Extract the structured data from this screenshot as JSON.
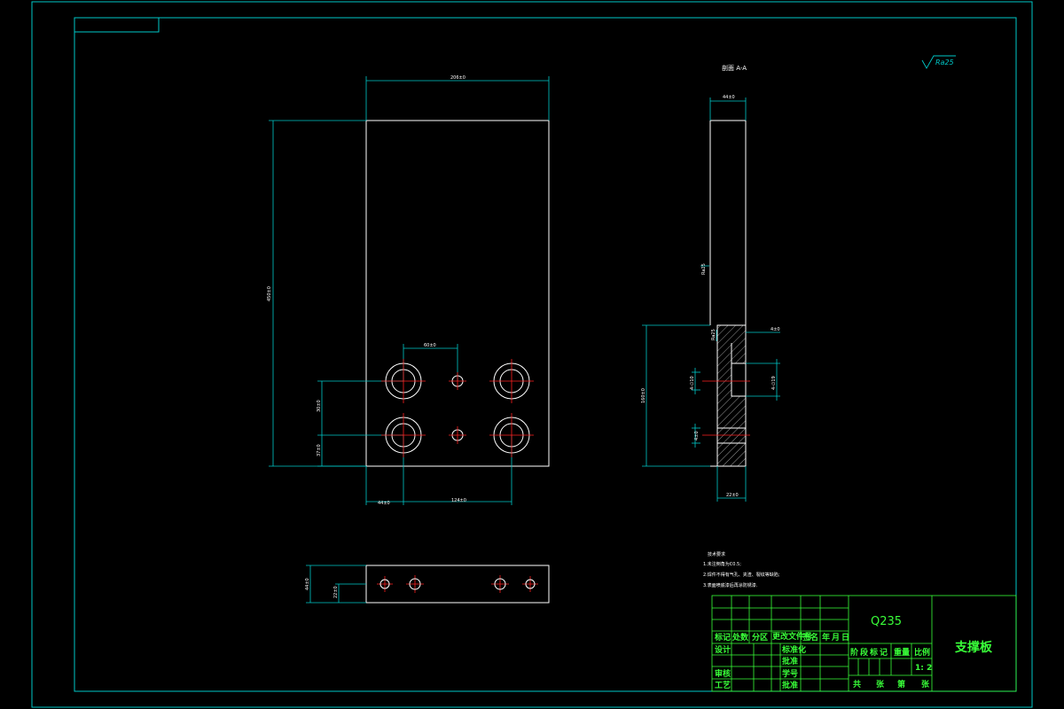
{
  "drawing": {
    "section_label": "剖面 A-A",
    "roughness_label": "Ra25",
    "material": "Q235",
    "part_name": "支撑板",
    "scale": "1: 2",
    "colors": {
      "background": "#000000",
      "frame": "#00c8c8",
      "outline": "#ffffff",
      "titleblock": "#39ff39",
      "centerline": "#ff2020"
    }
  },
  "dimensions": {
    "front_top_width": "206±0",
    "front_height": "450±0",
    "hole_spacing_top": "60±0",
    "hole_row_top": "30±0",
    "hole_row_bottom": "37±0",
    "bottom_left": "44±0",
    "bottom_hole_span": "124±0",
    "side_top": "44±0",
    "side_right_top": "4±0",
    "side_bore_right": "4-∅19",
    "side_bore_left": "4-∅10",
    "side_height": "160±0",
    "side_bottom": "22±0",
    "side_small": "4±0",
    "bottom_view_h1": "44±0",
    "bottom_view_h2": "22±0",
    "roughness_side_1": "Ra25",
    "roughness_side_2": "Ra25"
  },
  "technical_notes": {
    "title": "技术要求",
    "lines": [
      "1.未注倒角为C0.5;",
      "2.焊件不得有气孔、夹渣、裂纹等缺陷;",
      "3.表面喷底漆后再涂防锈漆."
    ]
  },
  "title_block": {
    "row_labels": [
      "标记",
      "处数",
      "分区",
      "更改文件号",
      "签名",
      "年",
      "月",
      "日"
    ],
    "left_labels": [
      "设计",
      "审核",
      "工艺"
    ],
    "mid_labels": [
      "标准化",
      "批准",
      "学号",
      "批准"
    ],
    "stage_headers": [
      "阶段标记",
      "重量",
      "比例"
    ],
    "sheet_labels": [
      "共",
      "张",
      "第",
      "张"
    ]
  }
}
